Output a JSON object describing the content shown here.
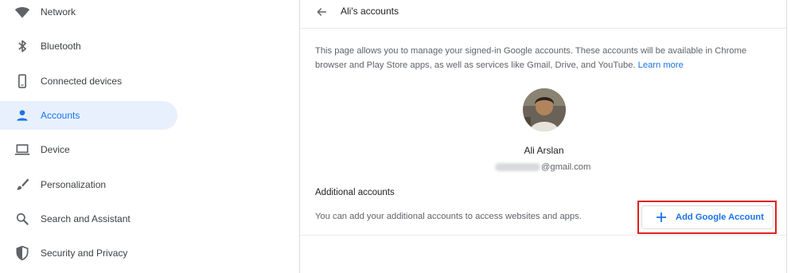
{
  "sidebar": {
    "items": [
      {
        "label": "Network",
        "icon": "wifi-icon"
      },
      {
        "label": "Bluetooth",
        "icon": "bluetooth-icon"
      },
      {
        "label": "Connected devices",
        "icon": "phone-icon"
      },
      {
        "label": "Accounts",
        "icon": "person-icon",
        "selected": true
      },
      {
        "label": "Device",
        "icon": "laptop-icon"
      },
      {
        "label": "Personalization",
        "icon": "brush-icon"
      },
      {
        "label": "Search and Assistant",
        "icon": "search-icon"
      },
      {
        "label": "Security and Privacy",
        "icon": "shield-icon"
      }
    ]
  },
  "main": {
    "title": "Ali's accounts",
    "description": "This page allows you to manage your signed-in Google accounts. These accounts will be available in Chrome browser and Play Store apps, as well as services like Gmail, Drive, and YouTube.",
    "learn_more": "Learn more",
    "account": {
      "name": "Ali Arslan",
      "email_visible": "@gmail.com"
    },
    "additional": {
      "heading": "Additional accounts",
      "text": "You can add your additional accounts to access websites and apps.",
      "add_button_label": "Add Google Account"
    }
  },
  "colors": {
    "accent": "#1a73e8",
    "selected_bg": "#e8f0fe",
    "highlight_box": "#e0201a"
  }
}
